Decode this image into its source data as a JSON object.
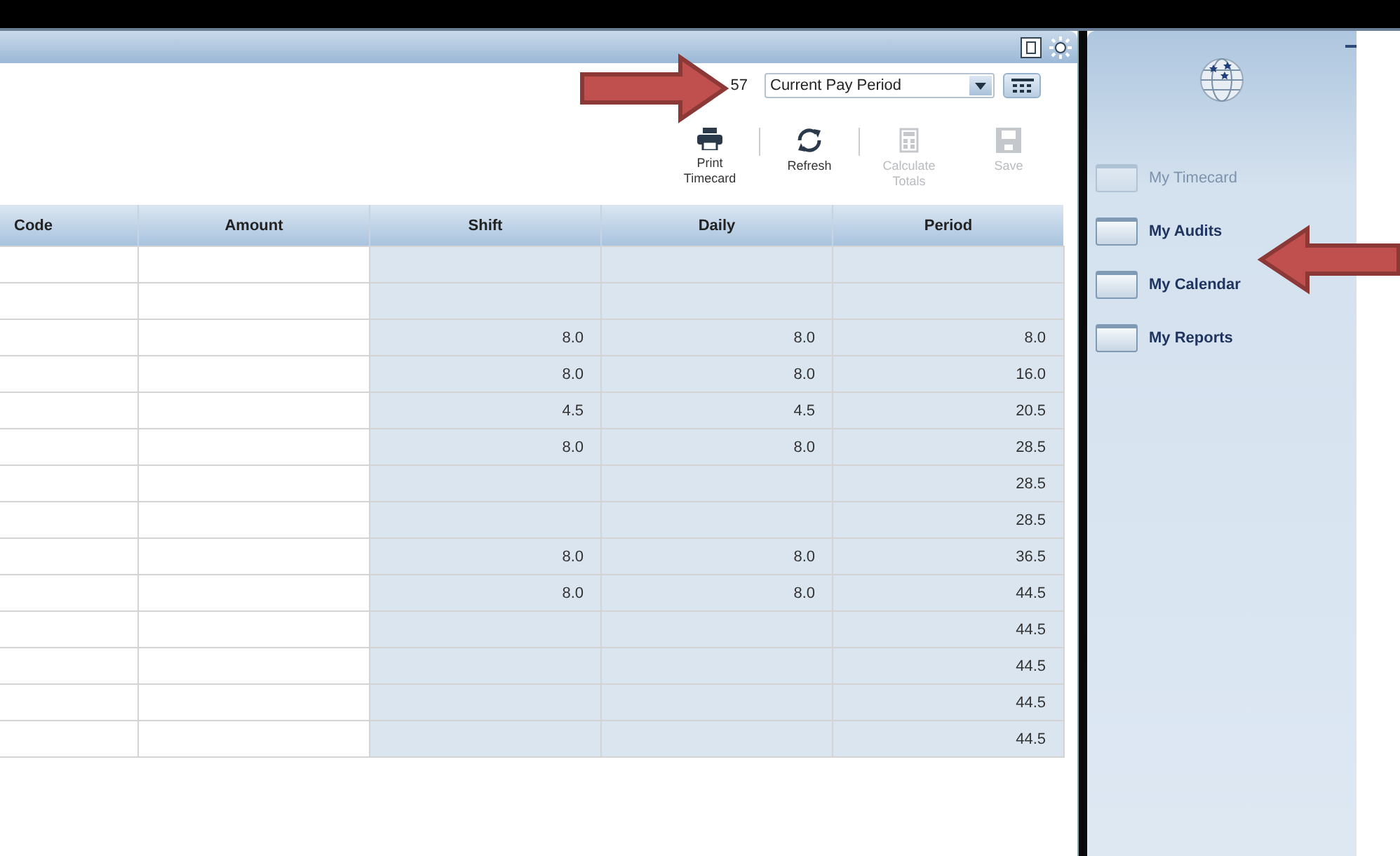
{
  "period_label": "57",
  "period_select": {
    "value": "Current Pay Period"
  },
  "toolbar": [
    {
      "label": "Print Timecard",
      "kind": "print",
      "disabled": false
    },
    {
      "label": "Refresh",
      "kind": "refresh",
      "disabled": false
    },
    {
      "label": "Calculate Totals",
      "kind": "calculate",
      "disabled": true
    },
    {
      "label": "Save",
      "kind": "save",
      "disabled": true
    }
  ],
  "table": {
    "columns": [
      "Code",
      "Amount",
      "Shift",
      "Daily",
      "Period"
    ],
    "rows": [
      {},
      {},
      {
        "shift": "8.0",
        "daily": "8.0",
        "period": "8.0"
      },
      {
        "shift": "8.0",
        "daily": "8.0",
        "period": "16.0"
      },
      {
        "shift": "4.5",
        "daily": "4.5",
        "period": "20.5"
      },
      {
        "shift": "8.0",
        "daily": "8.0",
        "period": "28.5"
      },
      {
        "period": "28.5"
      },
      {
        "period": "28.5"
      },
      {
        "shift": "8.0",
        "daily": "8.0",
        "period": "36.5"
      },
      {
        "shift": "8.0",
        "daily": "8.0",
        "period": "44.5"
      },
      {
        "period": "44.5"
      },
      {
        "period": "44.5"
      },
      {
        "period": "44.5"
      },
      {
        "period": "44.5"
      }
    ]
  },
  "sidebar": {
    "items": [
      {
        "label": "My Timecard",
        "disabled": true
      },
      {
        "label": "My Audits",
        "disabled": false
      },
      {
        "label": "My Calendar",
        "disabled": false
      },
      {
        "label": "My Reports",
        "disabled": false
      }
    ]
  }
}
